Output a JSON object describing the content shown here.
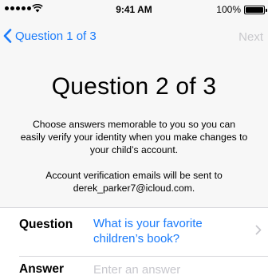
{
  "status_bar": {
    "time": "9:41 AM",
    "battery_percent": "100%",
    "battery_level": 1.0,
    "icons": [
      "signal-dots-icon",
      "wifi-icon",
      "battery-icon"
    ]
  },
  "nav": {
    "back_label": "Question 1 of 3",
    "next_label": "Next",
    "back_icon": "chevron-left-icon"
  },
  "page": {
    "title": "Question 2 of 3",
    "description": "Choose answers memorable to you so you can easily verify your identity when you make changes to your child’s account.",
    "email_note": "Account verification emails will be sent to derek_parker7@icloud.com."
  },
  "form": {
    "question_label": "Question",
    "question_value": "What is your favorite children’s book?",
    "question_icon": "chevron-right-icon",
    "answer_label": "Answer",
    "answer_value": "",
    "answer_placeholder": "Enter an answer"
  },
  "colors": {
    "accent": "#1a7bfb",
    "disabled": "#c8c8cc",
    "background": "#f7f7f7",
    "placeholder": "#c7c7cd"
  }
}
